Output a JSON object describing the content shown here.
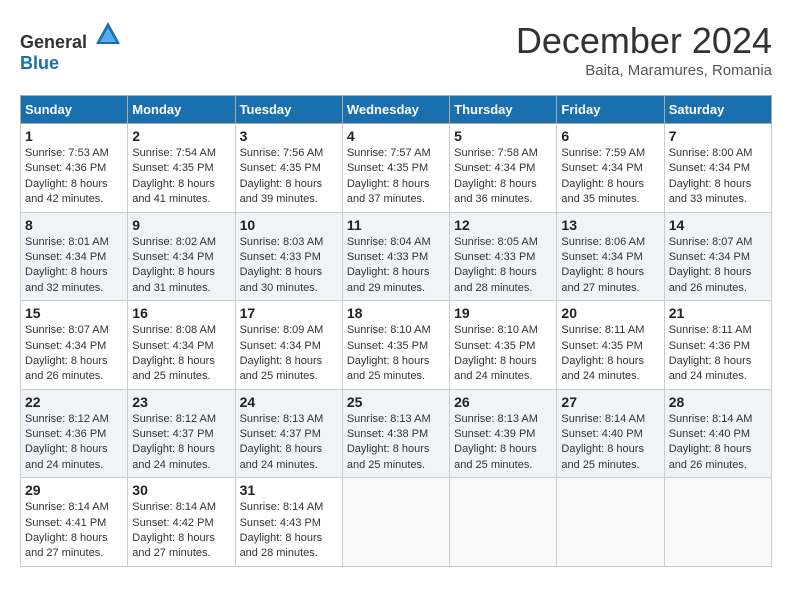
{
  "header": {
    "logo_general": "General",
    "logo_blue": "Blue",
    "month_title": "December 2024",
    "location": "Baita, Maramures, Romania"
  },
  "columns": [
    "Sunday",
    "Monday",
    "Tuesday",
    "Wednesday",
    "Thursday",
    "Friday",
    "Saturday"
  ],
  "weeks": [
    [
      {
        "day": "1",
        "sunrise": "Sunrise: 7:53 AM",
        "sunset": "Sunset: 4:36 PM",
        "daylight": "Daylight: 8 hours and 42 minutes."
      },
      {
        "day": "2",
        "sunrise": "Sunrise: 7:54 AM",
        "sunset": "Sunset: 4:35 PM",
        "daylight": "Daylight: 8 hours and 41 minutes."
      },
      {
        "day": "3",
        "sunrise": "Sunrise: 7:56 AM",
        "sunset": "Sunset: 4:35 PM",
        "daylight": "Daylight: 8 hours and 39 minutes."
      },
      {
        "day": "4",
        "sunrise": "Sunrise: 7:57 AM",
        "sunset": "Sunset: 4:35 PM",
        "daylight": "Daylight: 8 hours and 37 minutes."
      },
      {
        "day": "5",
        "sunrise": "Sunrise: 7:58 AM",
        "sunset": "Sunset: 4:34 PM",
        "daylight": "Daylight: 8 hours and 36 minutes."
      },
      {
        "day": "6",
        "sunrise": "Sunrise: 7:59 AM",
        "sunset": "Sunset: 4:34 PM",
        "daylight": "Daylight: 8 hours and 35 minutes."
      },
      {
        "day": "7",
        "sunrise": "Sunrise: 8:00 AM",
        "sunset": "Sunset: 4:34 PM",
        "daylight": "Daylight: 8 hours and 33 minutes."
      }
    ],
    [
      {
        "day": "8",
        "sunrise": "Sunrise: 8:01 AM",
        "sunset": "Sunset: 4:34 PM",
        "daylight": "Daylight: 8 hours and 32 minutes."
      },
      {
        "day": "9",
        "sunrise": "Sunrise: 8:02 AM",
        "sunset": "Sunset: 4:34 PM",
        "daylight": "Daylight: 8 hours and 31 minutes."
      },
      {
        "day": "10",
        "sunrise": "Sunrise: 8:03 AM",
        "sunset": "Sunset: 4:33 PM",
        "daylight": "Daylight: 8 hours and 30 minutes."
      },
      {
        "day": "11",
        "sunrise": "Sunrise: 8:04 AM",
        "sunset": "Sunset: 4:33 PM",
        "daylight": "Daylight: 8 hours and 29 minutes."
      },
      {
        "day": "12",
        "sunrise": "Sunrise: 8:05 AM",
        "sunset": "Sunset: 4:33 PM",
        "daylight": "Daylight: 8 hours and 28 minutes."
      },
      {
        "day": "13",
        "sunrise": "Sunrise: 8:06 AM",
        "sunset": "Sunset: 4:34 PM",
        "daylight": "Daylight: 8 hours and 27 minutes."
      },
      {
        "day": "14",
        "sunrise": "Sunrise: 8:07 AM",
        "sunset": "Sunset: 4:34 PM",
        "daylight": "Daylight: 8 hours and 26 minutes."
      }
    ],
    [
      {
        "day": "15",
        "sunrise": "Sunrise: 8:07 AM",
        "sunset": "Sunset: 4:34 PM",
        "daylight": "Daylight: 8 hours and 26 minutes."
      },
      {
        "day": "16",
        "sunrise": "Sunrise: 8:08 AM",
        "sunset": "Sunset: 4:34 PM",
        "daylight": "Daylight: 8 hours and 25 minutes."
      },
      {
        "day": "17",
        "sunrise": "Sunrise: 8:09 AM",
        "sunset": "Sunset: 4:34 PM",
        "daylight": "Daylight: 8 hours and 25 minutes."
      },
      {
        "day": "18",
        "sunrise": "Sunrise: 8:10 AM",
        "sunset": "Sunset: 4:35 PM",
        "daylight": "Daylight: 8 hours and 25 minutes."
      },
      {
        "day": "19",
        "sunrise": "Sunrise: 8:10 AM",
        "sunset": "Sunset: 4:35 PM",
        "daylight": "Daylight: 8 hours and 24 minutes."
      },
      {
        "day": "20",
        "sunrise": "Sunrise: 8:11 AM",
        "sunset": "Sunset: 4:35 PM",
        "daylight": "Daylight: 8 hours and 24 minutes."
      },
      {
        "day": "21",
        "sunrise": "Sunrise: 8:11 AM",
        "sunset": "Sunset: 4:36 PM",
        "daylight": "Daylight: 8 hours and 24 minutes."
      }
    ],
    [
      {
        "day": "22",
        "sunrise": "Sunrise: 8:12 AM",
        "sunset": "Sunset: 4:36 PM",
        "daylight": "Daylight: 8 hours and 24 minutes."
      },
      {
        "day": "23",
        "sunrise": "Sunrise: 8:12 AM",
        "sunset": "Sunset: 4:37 PM",
        "daylight": "Daylight: 8 hours and 24 minutes."
      },
      {
        "day": "24",
        "sunrise": "Sunrise: 8:13 AM",
        "sunset": "Sunset: 4:37 PM",
        "daylight": "Daylight: 8 hours and 24 minutes."
      },
      {
        "day": "25",
        "sunrise": "Sunrise: 8:13 AM",
        "sunset": "Sunset: 4:38 PM",
        "daylight": "Daylight: 8 hours and 25 minutes."
      },
      {
        "day": "26",
        "sunrise": "Sunrise: 8:13 AM",
        "sunset": "Sunset: 4:39 PM",
        "daylight": "Daylight: 8 hours and 25 minutes."
      },
      {
        "day": "27",
        "sunrise": "Sunrise: 8:14 AM",
        "sunset": "Sunset: 4:40 PM",
        "daylight": "Daylight: 8 hours and 25 minutes."
      },
      {
        "day": "28",
        "sunrise": "Sunrise: 8:14 AM",
        "sunset": "Sunset: 4:40 PM",
        "daylight": "Daylight: 8 hours and 26 minutes."
      }
    ],
    [
      {
        "day": "29",
        "sunrise": "Sunrise: 8:14 AM",
        "sunset": "Sunset: 4:41 PM",
        "daylight": "Daylight: 8 hours and 27 minutes."
      },
      {
        "day": "30",
        "sunrise": "Sunrise: 8:14 AM",
        "sunset": "Sunset: 4:42 PM",
        "daylight": "Daylight: 8 hours and 27 minutes."
      },
      {
        "day": "31",
        "sunrise": "Sunrise: 8:14 AM",
        "sunset": "Sunset: 4:43 PM",
        "daylight": "Daylight: 8 hours and 28 minutes."
      },
      null,
      null,
      null,
      null
    ]
  ]
}
